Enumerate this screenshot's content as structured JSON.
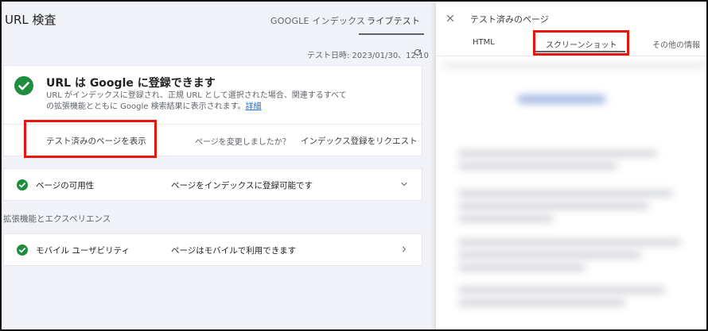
{
  "header": {
    "title": "URL 検査",
    "tabs": [
      {
        "label": "GOOGLE インデックス"
      },
      {
        "label": "ライブテスト"
      }
    ]
  },
  "test_date": "テスト日時: 2023/01/30、12:10",
  "status_card": {
    "headline": "URL は Google に登録できます",
    "description": "URL がインデックスに登録され、正規 URL として選択された場合、関連するすべての拡張機能とともに Google 検索結果に表示されます。",
    "more_link": "詳細",
    "view_tested_label": "テスト済みのページを表示",
    "changed_question": "ページを変更しましたか？",
    "request_index_label": "インデックス登録をリクエスト"
  },
  "availability": {
    "label": "ページの可用性",
    "value": "ページをインデックスに登録可能です"
  },
  "enhancements_section_label": "拡張機能とエクスペリエンス",
  "mobile": {
    "label": "モバイル ユーザビリティ",
    "value": "ページはモバイルで利用できます"
  },
  "side_panel": {
    "title": "テスト済みのページ",
    "tabs": [
      {
        "label": "HTML"
      },
      {
        "label": "スクリーンショット"
      },
      {
        "label": "その他の情報"
      }
    ]
  },
  "colors": {
    "success_green": "#1e8e3e",
    "highlight_red": "#e8150c",
    "link_blue": "#1a73e8"
  },
  "icons": [
    "refresh-icon",
    "check-circle-icon",
    "check-circle-small-icon",
    "chevron-down-icon",
    "chevron-right-icon",
    "close-icon"
  ]
}
